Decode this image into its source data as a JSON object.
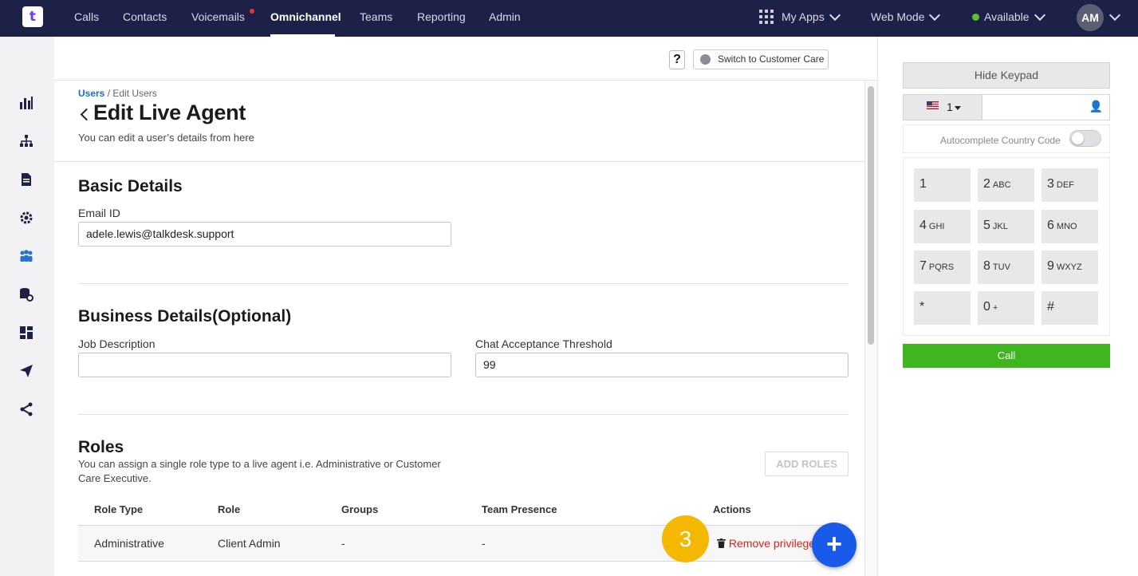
{
  "nav": {
    "logo": "t",
    "items": [
      "Calls",
      "Contacts",
      "Voicemails",
      "Omnichannel",
      "Teams",
      "Reporting",
      "Admin"
    ],
    "active": "Omnichannel",
    "my_apps": "My Apps",
    "web_mode": "Web Mode",
    "status": "Available",
    "avatar": "AM"
  },
  "sidebar": {
    "icons": [
      "bar-chart-icon",
      "org-chart-icon",
      "document-icon",
      "gear-icon",
      "people-icon",
      "database-settings-icon",
      "dashboard-icon",
      "send-icon",
      "share-icon"
    ],
    "active": "people-icon"
  },
  "toolbar": {
    "help": "?",
    "switch_label": "Switch to Customer Care"
  },
  "breadcrumb": {
    "link": "Users",
    "current": " / Edit Users"
  },
  "page": {
    "title": "Edit Live Agent",
    "subtitle": "You can edit a user’s details from here"
  },
  "basic": {
    "title": "Basic Details",
    "email_label": "Email ID",
    "email_value": "adele.lewis@talkdesk.support"
  },
  "business": {
    "title": "Business Details(Optional)",
    "job_label": "Job Description",
    "job_value": "",
    "threshold_label": "Chat Acceptance Threshold",
    "threshold_value": "99"
  },
  "roles": {
    "title": "Roles",
    "description": "You can assign a single role type to a live agent i.e. Administrative or Customer Care Executive.",
    "add_button": "ADD ROLES",
    "columns": [
      "Role Type",
      "Role",
      "Groups",
      "Team Presence",
      "Actions"
    ],
    "rows": [
      {
        "role_type": "Administrative",
        "role": "Client Admin",
        "groups": "-",
        "team_presence": "-",
        "action": "Remove privilege"
      }
    ]
  },
  "overlay": {
    "step_badge": "3",
    "fab": "+"
  },
  "dialer": {
    "hide_keypad": "Hide Keypad",
    "country_code": "1",
    "phone_placeholder": "",
    "autocomplete_label": "Autocomplete Country Code",
    "autocomplete_on": false,
    "keys": [
      {
        "digit": "1",
        "letters": ""
      },
      {
        "digit": "2",
        "letters": "ABC"
      },
      {
        "digit": "3",
        "letters": "DEF"
      },
      {
        "digit": "4",
        "letters": "GHI"
      },
      {
        "digit": "5",
        "letters": "JKL"
      },
      {
        "digit": "6",
        "letters": "MNO"
      },
      {
        "digit": "7",
        "letters": "PQRS"
      },
      {
        "digit": "8",
        "letters": "TUV"
      },
      {
        "digit": "9",
        "letters": "WXYZ"
      },
      {
        "digit": "*",
        "letters": ""
      },
      {
        "digit": "0",
        "letters": "+"
      },
      {
        "digit": "#",
        "letters": ""
      }
    ],
    "call": "Call"
  },
  "colors": {
    "nav_bg": "#1d2147",
    "accent_blue": "#1a5ae8",
    "call_green": "#3fb61f",
    "badge_yellow": "#f5b800",
    "danger_red": "#e0201a"
  }
}
